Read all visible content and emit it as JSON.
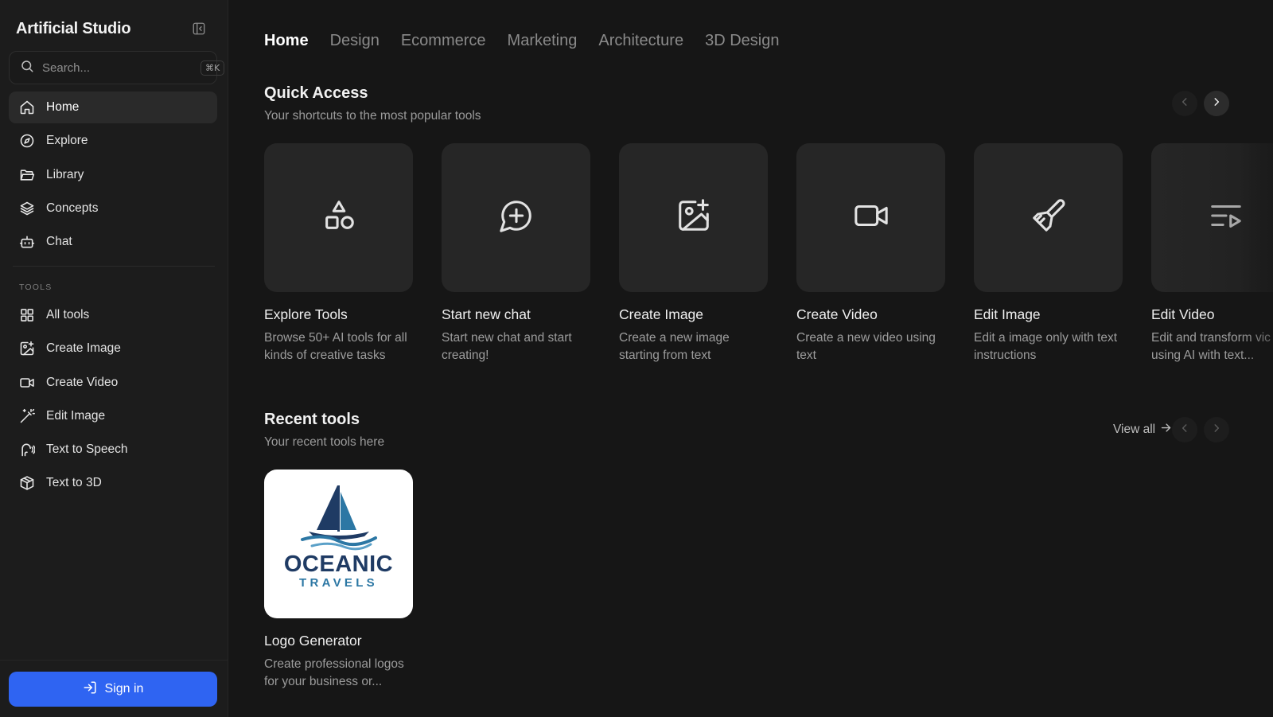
{
  "sidebar": {
    "brand": "Artificial Studio",
    "search": {
      "placeholder": "Search...",
      "shortcut": "⌘K"
    },
    "nav": [
      {
        "label": "Home",
        "icon": "home-icon",
        "active": true
      },
      {
        "label": "Explore",
        "icon": "compass-icon"
      },
      {
        "label": "Library",
        "icon": "folder-icon"
      },
      {
        "label": "Concepts",
        "icon": "layers-icon"
      },
      {
        "label": "Chat",
        "icon": "bot-icon"
      }
    ],
    "tools_label": "TOOLS",
    "tools": [
      {
        "label": "All tools",
        "icon": "grid-icon"
      },
      {
        "label": "Create Image",
        "icon": "image-plus-icon"
      },
      {
        "label": "Create Video",
        "icon": "video-icon"
      },
      {
        "label": "Edit Image",
        "icon": "wand-icon"
      },
      {
        "label": "Text to Speech",
        "icon": "speech-icon"
      },
      {
        "label": "Text to 3D",
        "icon": "cube-icon"
      }
    ],
    "sign_in": "Sign in"
  },
  "main": {
    "tabs": [
      {
        "label": "Home",
        "active": true
      },
      {
        "label": "Design"
      },
      {
        "label": "Ecommerce"
      },
      {
        "label": "Marketing"
      },
      {
        "label": "Architecture"
      },
      {
        "label": "3D Design"
      }
    ],
    "quick_access": {
      "title": "Quick Access",
      "subtitle": "Your shortcuts to the most popular tools",
      "cards": [
        {
          "title": "Explore Tools",
          "desc": "Browse 50+ AI tools for all kinds of creative tasks",
          "icon": "shapes-icon"
        },
        {
          "title": "Start new chat",
          "desc": "Start new chat and start creating!",
          "icon": "message-plus-icon"
        },
        {
          "title": "Create Image",
          "desc": "Create a new image starting from text",
          "icon": "image-plus-icon"
        },
        {
          "title": "Create Video",
          "desc": "Create a new video using text",
          "icon": "video-icon"
        },
        {
          "title": "Edit Image",
          "desc": "Edit a image only with text instructions",
          "icon": "brush-icon"
        },
        {
          "title": "Edit Video",
          "desc": "Edit and transform vic using AI with text...",
          "desc_line1": "Edit and transform vic",
          "desc_line2": "using AI with text...",
          "icon": "list-video-icon"
        }
      ]
    },
    "recent": {
      "title": "Recent tools",
      "subtitle": "Your recent tools here",
      "view_all": "View all",
      "cards": [
        {
          "title": "Logo Generator",
          "desc": "Create professional logos for your business or...",
          "logo_word": "OCEANIC",
          "logo_sub": "TRAVELS"
        }
      ]
    }
  },
  "colors": {
    "accent": "#2f64f2",
    "background": "#161616",
    "sidebar": "#1c1c1c",
    "tile": "#262626"
  }
}
